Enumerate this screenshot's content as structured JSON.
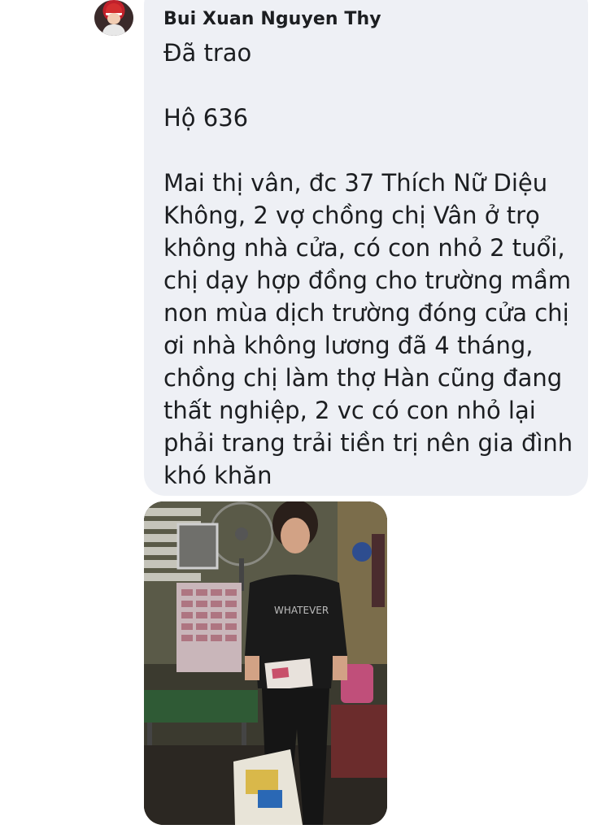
{
  "sender": {
    "name": "Bui Xuan Nguyen Thy"
  },
  "message": {
    "line1": "Đã trao",
    "line2": "Hộ 636",
    "paragraph": [
      "Mai thị vân, đc 37 Thích Nữ Diệu",
      "Không, 2 vợ chồng chị Vân ở trọ",
      "không nhà cửa, có con nhỏ 2 tuổi,",
      "chị dạy hợp đồng cho trường mầm",
      "non mùa dịch trường đóng cửa chị",
      "ơi nhà không lương đã 4 tháng,",
      "chồng chị làm thợ Hàn cũng đang",
      "thất nghiệp, 2 vc có con nhỏ lại",
      "phải trang trải tiền trị nên gia đình",
      "khó khăn"
    ]
  },
  "photo": {
    "shirt_text": "WHATEVER",
    "colors": {
      "bubble": "#eef0f5",
      "text": "#1c1e21"
    }
  }
}
